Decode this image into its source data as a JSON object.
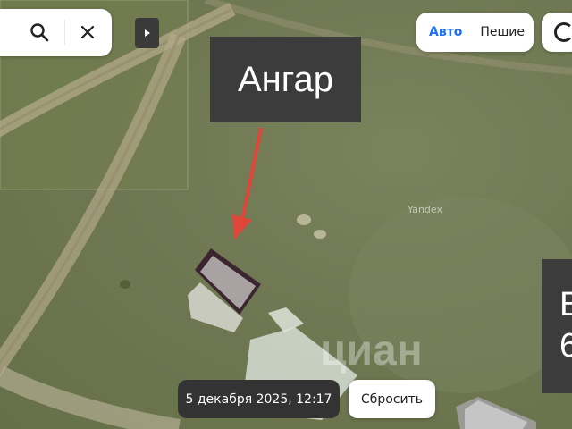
{
  "search": {
    "search_icon": "search-icon",
    "close_icon": "close-icon"
  },
  "panel_toggle": {
    "icon": "play-triangle-icon"
  },
  "route_modes": {
    "auto_label": "Авто",
    "walk_label": "Пешие"
  },
  "annotation": {
    "label": "Ангар"
  },
  "side_label": {
    "line1": "В",
    "line2": "6"
  },
  "map_marks": {
    "provider": "Yandex",
    "watermark": "циан"
  },
  "history": {
    "date_label": "5 декабря 2025, 12:17",
    "reset_label": "Сбросить"
  },
  "colors": {
    "accent": "#1f6ef5",
    "arrow": "#e0453a",
    "dark_chip": "#333333"
  }
}
